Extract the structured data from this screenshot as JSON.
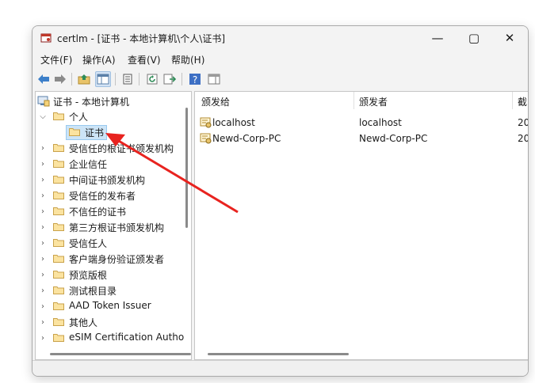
{
  "window": {
    "title": "certlm - [证书 - 本地计算机\\个人\\证书]"
  },
  "controls": {
    "minimize": "—",
    "maximize": "▢",
    "close": "✕"
  },
  "menu": [
    {
      "label": "文件(F)"
    },
    {
      "label": "操作(A)"
    },
    {
      "label": "查看(V)"
    },
    {
      "label": "帮助(H)"
    }
  ],
  "toolbar": {
    "icons": [
      "back-icon",
      "forward-icon",
      "up-folder-icon",
      "show-hide-tree-icon",
      "properties-icon",
      "refresh-icon",
      "export-list-icon",
      "help-icon",
      "show-pane-icon"
    ]
  },
  "tree": {
    "root": "证书 - 本地计算机",
    "personal": "个人",
    "personal_child": "证书",
    "stores": [
      "受信任的根证书颁发机构",
      "企业信任",
      "中间证书颁发机构",
      "受信任的发布者",
      "不信任的证书",
      "第三方根证书颁发机构",
      "受信任人",
      "客户端身份验证颁发者",
      "预览版根",
      "测试根目录",
      "AAD Token Issuer",
      "其他人",
      "eSIM Certification Autho"
    ]
  },
  "list": {
    "columns": [
      "颁发给",
      "颁发者",
      "截"
    ],
    "sort_indicator": "˄",
    "rows": [
      {
        "issued_to": "localhost",
        "issued_by": "localhost",
        "expires": "20"
      },
      {
        "issued_to": "Newd-Corp-PC",
        "issued_by": "Newd-Corp-PC",
        "expires": "20"
      }
    ]
  },
  "colors": {
    "annotation_arrow": "#e8231f",
    "selection": "#cce4f7",
    "folder": "#f5d37a"
  }
}
